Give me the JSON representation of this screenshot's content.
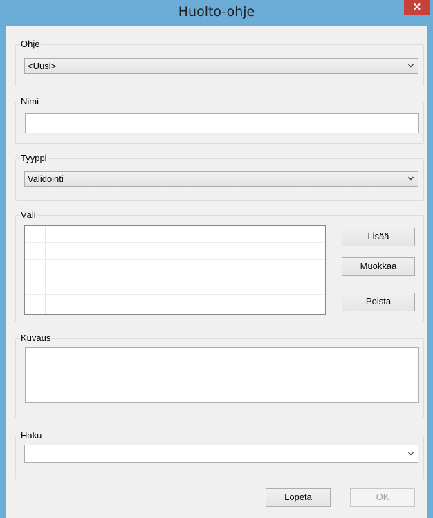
{
  "window": {
    "title": "Huolto-ohje",
    "close_glyph": "✕"
  },
  "ohje": {
    "legend": "Ohje",
    "selected": "<Uusi>"
  },
  "nimi": {
    "legend": "Nimi",
    "value": ""
  },
  "tyyppi": {
    "legend": "Tyyppi",
    "selected": "Validointi"
  },
  "vali": {
    "legend": "Väli",
    "buttons": {
      "add": "Lisää",
      "edit": "Muokkaa",
      "delete": "Poista"
    }
  },
  "kuvaus": {
    "legend": "Kuvaus",
    "value": ""
  },
  "haku": {
    "legend": "Haku",
    "selected": ""
  },
  "footer": {
    "close_label": "Lopeta",
    "ok_label": "OK"
  },
  "icons": {
    "dropdown": "chevron-down-icon",
    "close": "close-icon"
  },
  "colors": {
    "titlebar": "#6badd6",
    "close_button": "#c7403a",
    "client_background": "#f0f0f0"
  }
}
